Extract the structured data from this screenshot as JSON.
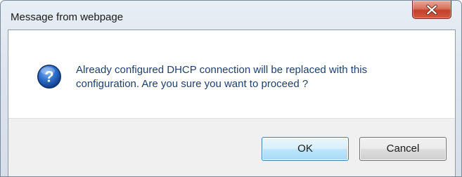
{
  "dialog": {
    "title": "Message from webpage",
    "message_line1": "Already configured DHCP connection will be replaced with this",
    "message_line2": "configuration. Are you sure you want to proceed ?",
    "icon": "question-icon",
    "close_icon": "close-icon"
  },
  "buttons": {
    "ok_label": "OK",
    "cancel_label": "Cancel"
  },
  "colors": {
    "message_text": "#1e3f6e",
    "close_button": "#c4402a",
    "ok_border": "#3c7fb1",
    "question_icon": "#1f5bb4"
  }
}
